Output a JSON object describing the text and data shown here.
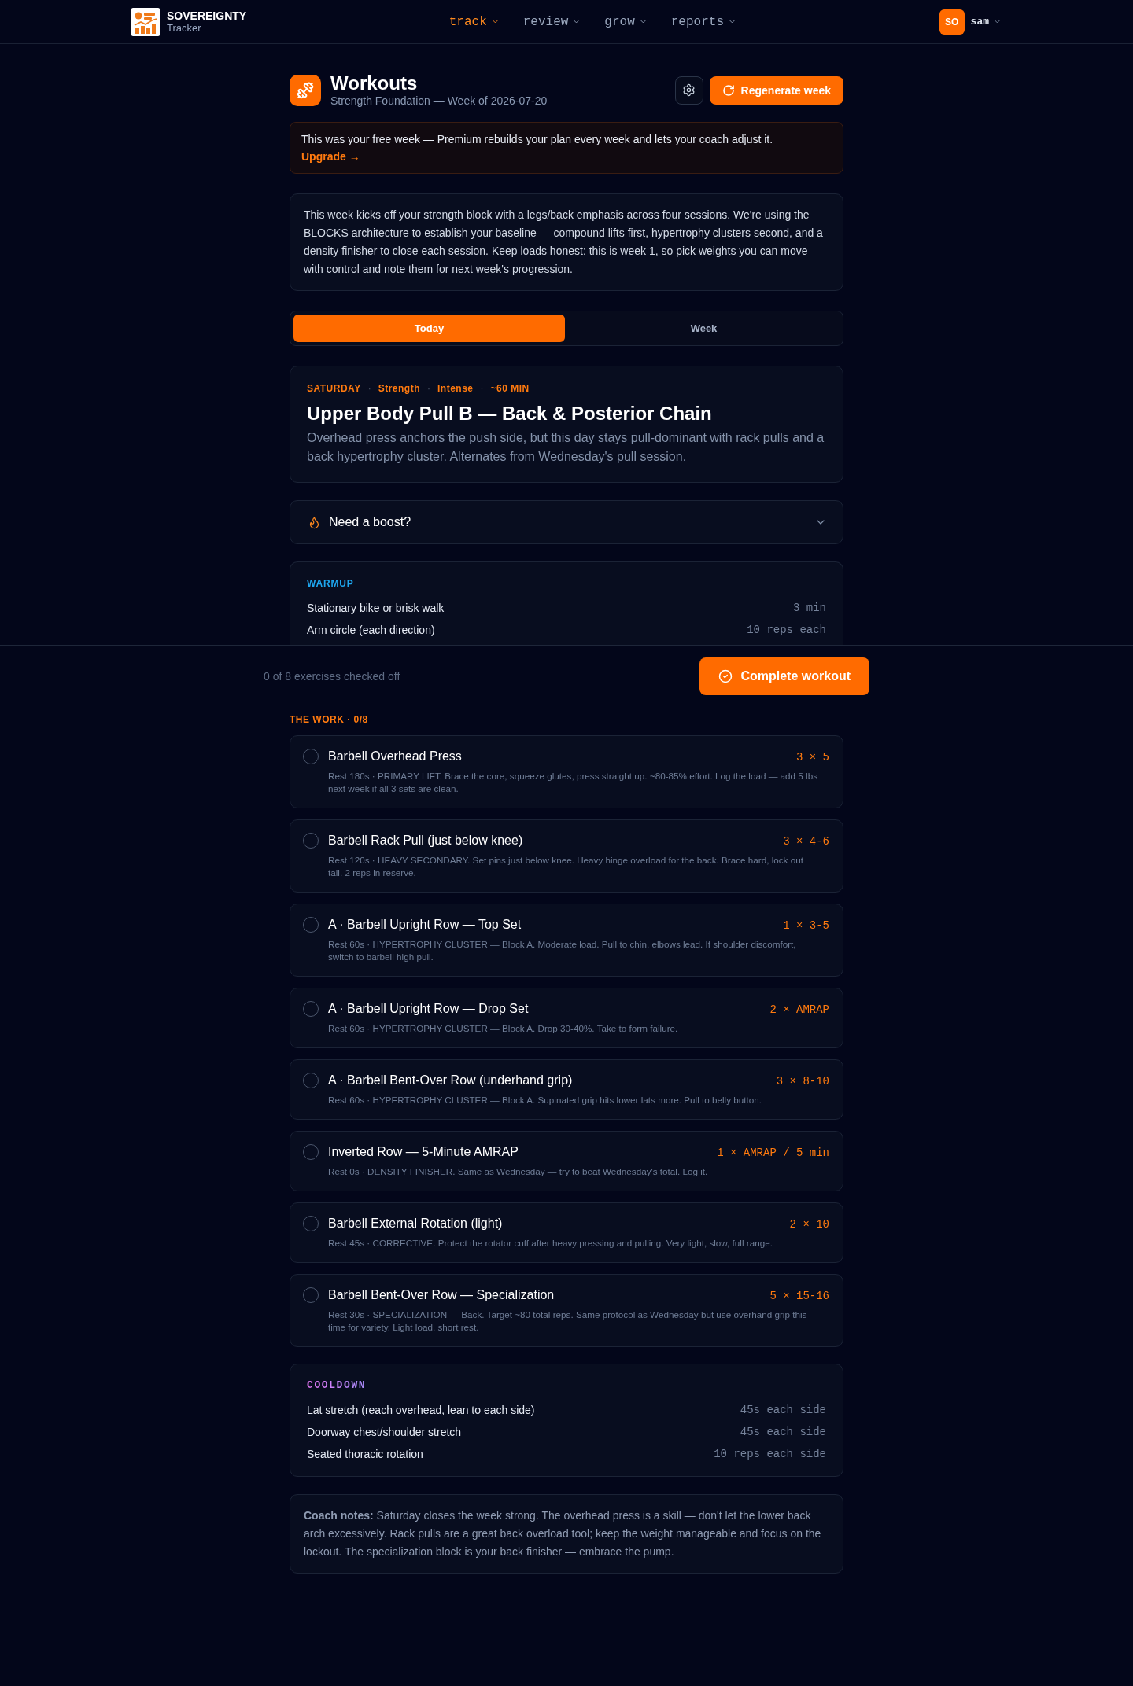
{
  "header": {
    "brand": "SOVEREIGNTY",
    "tagline": "Tracker",
    "nav": [
      {
        "label": "track",
        "selected": true
      },
      {
        "label": "review",
        "selected": false
      },
      {
        "label": "grow",
        "selected": false
      },
      {
        "label": "reports",
        "selected": false
      }
    ],
    "user": {
      "initials": "SO",
      "name": "sam"
    }
  },
  "page": {
    "title": "Workouts",
    "subtitle": "Strength Foundation — Week of 2026-07-20",
    "action": "Regenerate week"
  },
  "banner": {
    "text": "This was your free week — Premium rebuilds your plan every week and lets your coach adjust it.",
    "link": "Upgrade →"
  },
  "summary": "This week kicks off your strength block with a legs/back emphasis across four sessions. We're using the BLOCKS architecture to establish your baseline — compound lifts first, hypertrophy clusters second, and a density finisher to close each session. Keep loads honest: this is week 1, so pick weights you can move with control and note them for next week's progression.",
  "tabs": [
    {
      "label": "Today",
      "selected": true
    },
    {
      "label": "Week",
      "selected": false
    }
  ],
  "day": {
    "meta": [
      "SATURDAY",
      "Strength",
      "Intense",
      "~60 MIN"
    ],
    "separator": "·",
    "title": "Upper Body Pull B — Back & Posterior Chain",
    "description": "Overhead press anchors the push side, but this day stays pull-dominant with rack pulls and a back hypertrophy cluster. Alternates from Wednesday's pull session."
  },
  "boost": {
    "label": "Need a boost?",
    "expanded": false
  },
  "warmup": {
    "title": "WARMUP",
    "items": [
      {
        "name": "Stationary bike or brisk walk",
        "amount": "3 min"
      },
      {
        "name": "Arm circle (each direction)",
        "amount": "10 reps each"
      }
    ]
  },
  "action_bar": {
    "text": "0 of 8 exercises checked off",
    "button": "Complete workout"
  },
  "work": {
    "title": "THE WORK · 0/8",
    "exercises": [
      {
        "name": "Barbell Overhead Press",
        "sets": "3 × 5",
        "notes": "Rest 180s · PRIMARY LIFT. Brace the core, squeeze glutes, press straight up. ~80-85% effort. Log the load — add 5 lbs next week if all 3 sets are clean.",
        "checked": false
      },
      {
        "name": "Barbell Rack Pull (just below knee)",
        "sets": "3 × 4-6",
        "notes": "Rest 120s · HEAVY SECONDARY. Set pins just below knee. Heavy hinge overload for the back. Brace hard, lock out tall. 2 reps in reserve.",
        "checked": false
      },
      {
        "name": "A · Barbell Upright Row — Top Set",
        "sets": "1 × 3-5",
        "notes": "Rest 60s · HYPERTROPHY CLUSTER — Block A. Moderate load. Pull to chin, elbows lead. If shoulder discomfort, switch to barbell high pull.",
        "checked": false
      },
      {
        "name": "A · Barbell Upright Row — Drop Set",
        "sets": "2 × AMRAP",
        "notes": "Rest 60s · HYPERTROPHY CLUSTER — Block A. Drop 30-40%. Take to form failure.",
        "checked": false
      },
      {
        "name": "A · Barbell Bent-Over Row (underhand grip)",
        "sets": "3 × 8-10",
        "notes": "Rest 60s · HYPERTROPHY CLUSTER — Block A. Supinated grip hits lower lats more. Pull to belly button.",
        "checked": false
      },
      {
        "name": "Inverted Row — 5-Minute AMRAP",
        "sets": "1 × AMRAP / 5 min",
        "notes": "Rest 0s · DENSITY FINISHER. Same as Wednesday — try to beat Wednesday's total. Log it.",
        "checked": false
      },
      {
        "name": "Barbell External Rotation (light)",
        "sets": "2 × 10",
        "notes": "Rest 45s · CORRECTIVE. Protect the rotator cuff after heavy pressing and pulling. Very light, slow, full range.",
        "checked": false
      },
      {
        "name": "Barbell Bent-Over Row — Specialization",
        "sets": "5 × 15-16",
        "notes": "Rest 30s · SPECIALIZATION — Back. Target ~80 total reps. Same protocol as Wednesday but use overhand grip this time for variety. Light load, short rest.",
        "checked": false
      }
    ]
  },
  "cooldown": {
    "title": "COOLDOWN",
    "items": [
      {
        "name": "Lat stretch (reach overhead, lean to each side)",
        "amount": "45s each side"
      },
      {
        "name": "Doorway chest/shoulder stretch",
        "amount": "45s each side"
      },
      {
        "name": "Seated thoracic rotation",
        "amount": "10 reps each side"
      }
    ]
  },
  "coach_notes": "**Coach notes:** Saturday closes the week strong. The overhead press is a skill — don't let the lower back arch excessively. Rack pulls are a great back overload tool; keep the weight manageable and focus on the lockout. The specialization block is your back finisher — embrace the pump."
}
